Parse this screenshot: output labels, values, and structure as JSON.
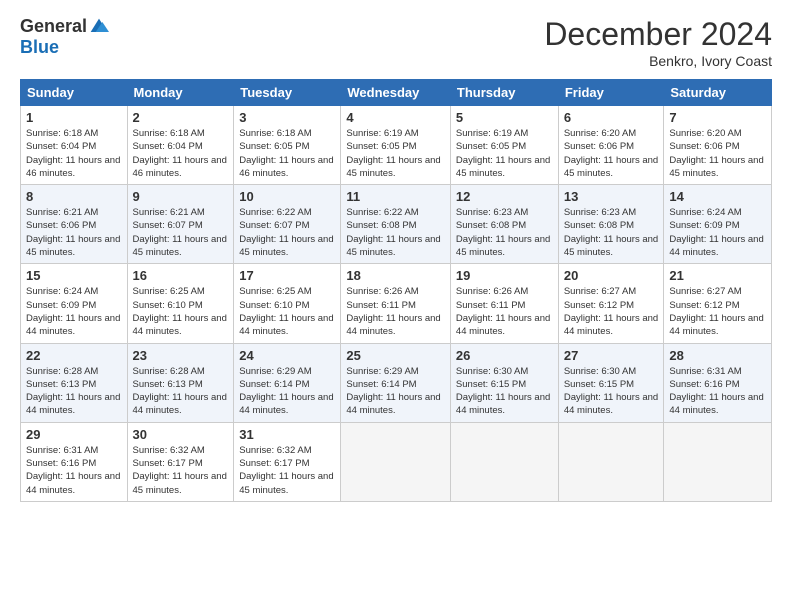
{
  "logo": {
    "general": "General",
    "blue": "Blue"
  },
  "title": "December 2024",
  "subtitle": "Benkro, Ivory Coast",
  "headers": [
    "Sunday",
    "Monday",
    "Tuesday",
    "Wednesday",
    "Thursday",
    "Friday",
    "Saturday"
  ],
  "weeks": [
    [
      {
        "day": "1",
        "sunrise": "6:18 AM",
        "sunset": "6:04 PM",
        "daylight": "11 hours and 46 minutes."
      },
      {
        "day": "2",
        "sunrise": "6:18 AM",
        "sunset": "6:04 PM",
        "daylight": "11 hours and 46 minutes."
      },
      {
        "day": "3",
        "sunrise": "6:18 AM",
        "sunset": "6:05 PM",
        "daylight": "11 hours and 46 minutes."
      },
      {
        "day": "4",
        "sunrise": "6:19 AM",
        "sunset": "6:05 PM",
        "daylight": "11 hours and 45 minutes."
      },
      {
        "day": "5",
        "sunrise": "6:19 AM",
        "sunset": "6:05 PM",
        "daylight": "11 hours and 45 minutes."
      },
      {
        "day": "6",
        "sunrise": "6:20 AM",
        "sunset": "6:06 PM",
        "daylight": "11 hours and 45 minutes."
      },
      {
        "day": "7",
        "sunrise": "6:20 AM",
        "sunset": "6:06 PM",
        "daylight": "11 hours and 45 minutes."
      }
    ],
    [
      {
        "day": "8",
        "sunrise": "6:21 AM",
        "sunset": "6:06 PM",
        "daylight": "11 hours and 45 minutes."
      },
      {
        "day": "9",
        "sunrise": "6:21 AM",
        "sunset": "6:07 PM",
        "daylight": "11 hours and 45 minutes."
      },
      {
        "day": "10",
        "sunrise": "6:22 AM",
        "sunset": "6:07 PM",
        "daylight": "11 hours and 45 minutes."
      },
      {
        "day": "11",
        "sunrise": "6:22 AM",
        "sunset": "6:08 PM",
        "daylight": "11 hours and 45 minutes."
      },
      {
        "day": "12",
        "sunrise": "6:23 AM",
        "sunset": "6:08 PM",
        "daylight": "11 hours and 45 minutes."
      },
      {
        "day": "13",
        "sunrise": "6:23 AM",
        "sunset": "6:08 PM",
        "daylight": "11 hours and 45 minutes."
      },
      {
        "day": "14",
        "sunrise": "6:24 AM",
        "sunset": "6:09 PM",
        "daylight": "11 hours and 44 minutes."
      }
    ],
    [
      {
        "day": "15",
        "sunrise": "6:24 AM",
        "sunset": "6:09 PM",
        "daylight": "11 hours and 44 minutes."
      },
      {
        "day": "16",
        "sunrise": "6:25 AM",
        "sunset": "6:10 PM",
        "daylight": "11 hours and 44 minutes."
      },
      {
        "day": "17",
        "sunrise": "6:25 AM",
        "sunset": "6:10 PM",
        "daylight": "11 hours and 44 minutes."
      },
      {
        "day": "18",
        "sunrise": "6:26 AM",
        "sunset": "6:11 PM",
        "daylight": "11 hours and 44 minutes."
      },
      {
        "day": "19",
        "sunrise": "6:26 AM",
        "sunset": "6:11 PM",
        "daylight": "11 hours and 44 minutes."
      },
      {
        "day": "20",
        "sunrise": "6:27 AM",
        "sunset": "6:12 PM",
        "daylight": "11 hours and 44 minutes."
      },
      {
        "day": "21",
        "sunrise": "6:27 AM",
        "sunset": "6:12 PM",
        "daylight": "11 hours and 44 minutes."
      }
    ],
    [
      {
        "day": "22",
        "sunrise": "6:28 AM",
        "sunset": "6:13 PM",
        "daylight": "11 hours and 44 minutes."
      },
      {
        "day": "23",
        "sunrise": "6:28 AM",
        "sunset": "6:13 PM",
        "daylight": "11 hours and 44 minutes."
      },
      {
        "day": "24",
        "sunrise": "6:29 AM",
        "sunset": "6:14 PM",
        "daylight": "11 hours and 44 minutes."
      },
      {
        "day": "25",
        "sunrise": "6:29 AM",
        "sunset": "6:14 PM",
        "daylight": "11 hours and 44 minutes."
      },
      {
        "day": "26",
        "sunrise": "6:30 AM",
        "sunset": "6:15 PM",
        "daylight": "11 hours and 44 minutes."
      },
      {
        "day": "27",
        "sunrise": "6:30 AM",
        "sunset": "6:15 PM",
        "daylight": "11 hours and 44 minutes."
      },
      {
        "day": "28",
        "sunrise": "6:31 AM",
        "sunset": "6:16 PM",
        "daylight": "11 hours and 44 minutes."
      }
    ],
    [
      {
        "day": "29",
        "sunrise": "6:31 AM",
        "sunset": "6:16 PM",
        "daylight": "11 hours and 44 minutes."
      },
      {
        "day": "30",
        "sunrise": "6:32 AM",
        "sunset": "6:17 PM",
        "daylight": "11 hours and 45 minutes."
      },
      {
        "day": "31",
        "sunrise": "6:32 AM",
        "sunset": "6:17 PM",
        "daylight": "11 hours and 45 minutes."
      },
      null,
      null,
      null,
      null
    ]
  ]
}
